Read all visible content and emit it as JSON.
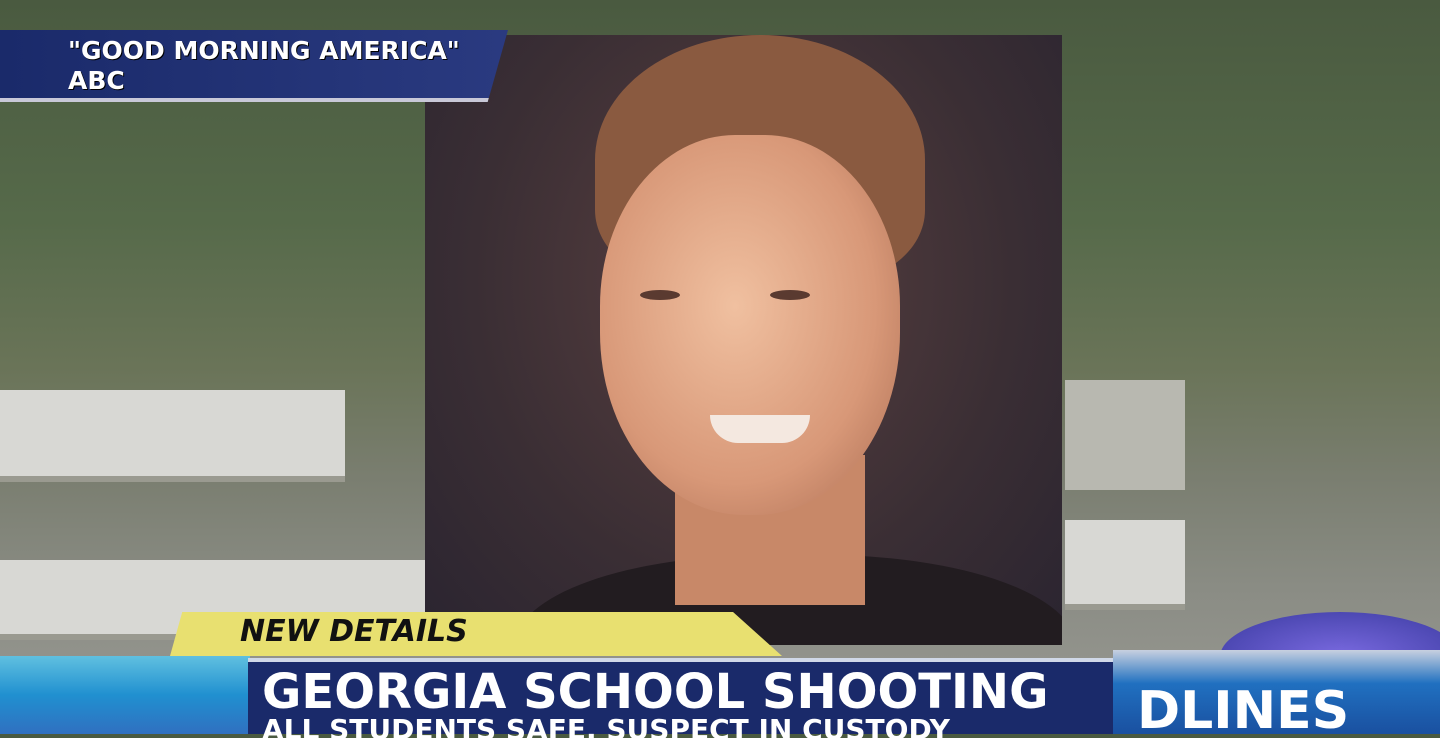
{
  "network_credit": {
    "line1": "\"GOOD MORNING AMERICA\"",
    "line2": "ABC"
  },
  "lower_third": {
    "tag": "NEW DETAILS",
    "headline": "GEORGIA SCHOOL SHOOTING",
    "subheadline": "ALL STUDENTS SAFE, SUSPECT IN CUSTODY",
    "section_label": "DLINES"
  },
  "colors": {
    "banner_blue": "#1a2a6a",
    "tag_yellow": "#e8e070"
  }
}
